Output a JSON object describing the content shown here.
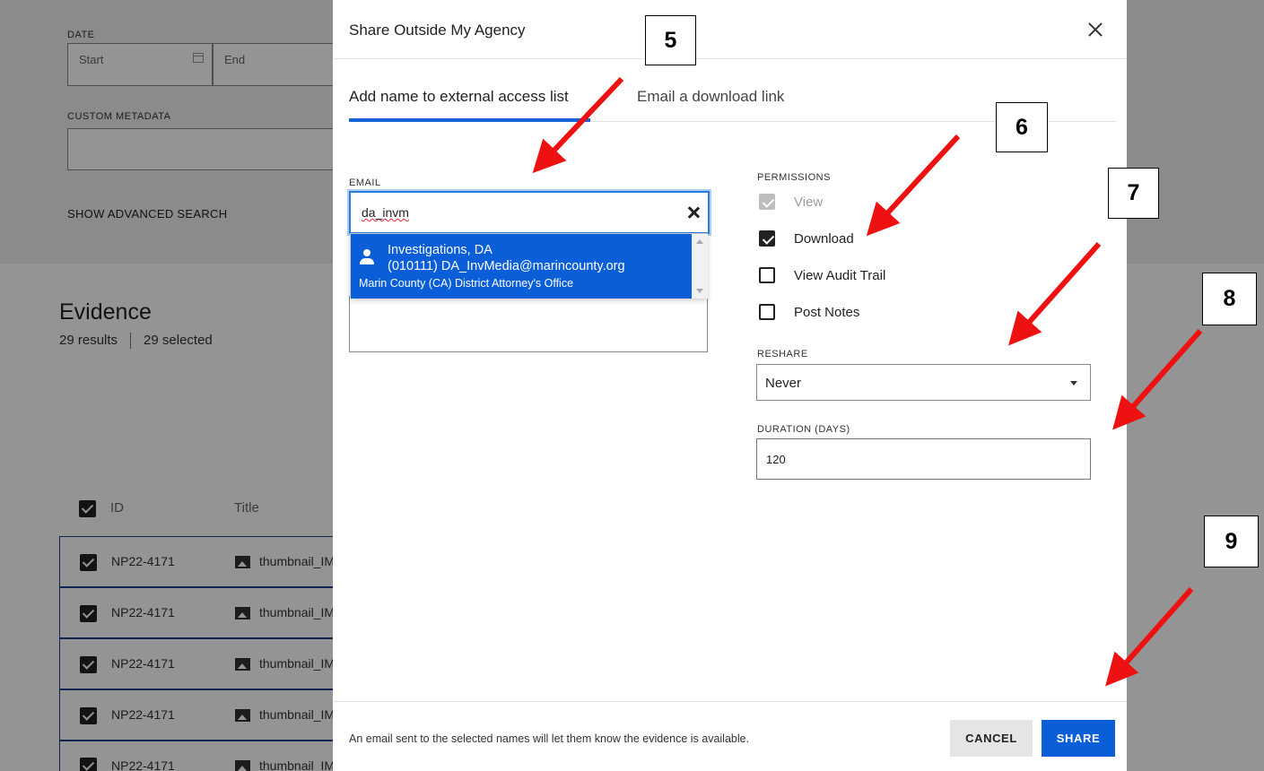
{
  "background": {
    "date_label": "DATE",
    "date_start_placeholder": "Start",
    "date_end_placeholder": "End",
    "custom_metadata_label": "CUSTOM METADATA",
    "advanced_search": "SHOW ADVANCED SEARCH",
    "evidence_title": "Evidence",
    "results_count": "29 results",
    "selected_count": "29 selected",
    "columns": {
      "id": "ID",
      "title": "Title"
    },
    "rows": [
      {
        "id": "NP22-4171",
        "title": "thumbnail_IM"
      },
      {
        "id": "NP22-4171",
        "title": "thumbnail_IM"
      },
      {
        "id": "NP22-4171",
        "title": "thumbnail_IM"
      },
      {
        "id": "NP22-4171",
        "title": "thumbnail_IM"
      },
      {
        "id": "NP22-4171",
        "title": "thumbnail_IM"
      }
    ]
  },
  "dialog": {
    "title": "Share Outside My Agency",
    "tabs": [
      {
        "label": "Add name to external access list",
        "active": true
      },
      {
        "label": "Email a download link",
        "active": false
      }
    ],
    "email": {
      "label": "EMAIL",
      "value": "da_invm"
    },
    "suggestion": {
      "name": "Investigations, DA",
      "email_line": "(010111)  DA_InvMedia@marincounty.org",
      "org": "Marin County (CA) District Attorney's Office"
    },
    "permissions": {
      "label": "PERMISSIONS",
      "items": [
        {
          "label": "View",
          "checked": true,
          "disabled": true
        },
        {
          "label": "Download",
          "checked": true,
          "disabled": false
        },
        {
          "label": "View Audit Trail",
          "checked": false,
          "disabled": false
        },
        {
          "label": "Post Notes",
          "checked": false,
          "disabled": false
        }
      ]
    },
    "reshare": {
      "label": "RESHARE",
      "value": "Never"
    },
    "duration": {
      "label": "DURATION (DAYS)",
      "value": "120"
    },
    "footer_note": "An email sent to the selected names will let them know the evidence is available.",
    "cancel_label": "CANCEL",
    "share_label": "SHARE"
  },
  "annotations": {
    "arrow_color": "#ee1111",
    "callouts": [
      "5",
      "6",
      "7",
      "8",
      "9"
    ]
  },
  "colors": {
    "primary": "#0a5ed7",
    "focus_ring": "#2b7de0",
    "overlay": "rgba(0,0,0,0.42)"
  }
}
